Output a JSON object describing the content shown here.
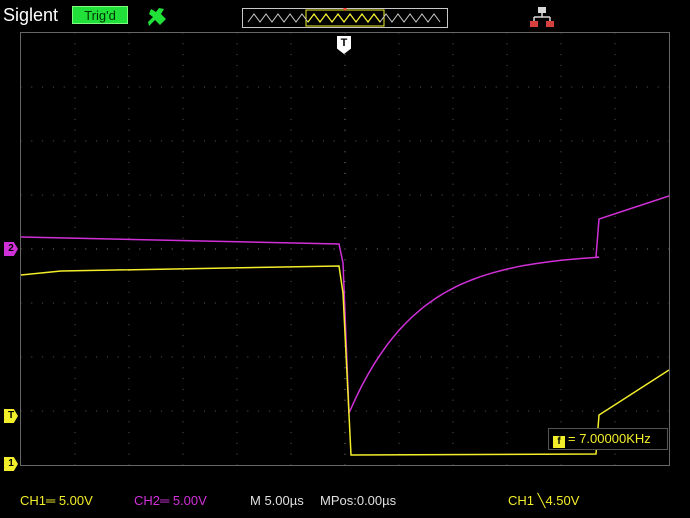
{
  "header": {
    "brand": "Siglent",
    "trigger_status": "Trig'd",
    "trigger_status_color": "#22e03a",
    "probe_icon": "probe-icon",
    "memory_icon": "memory-depth-icon",
    "network_icon": "network-icon"
  },
  "markers": {
    "ch2": "2",
    "trigger_level": "T",
    "ch1": "1",
    "trigger_position": "T"
  },
  "channels": {
    "ch1_color": "#f3ee2a",
    "ch2_color": "#d030d8"
  },
  "measurement": {
    "icon": "f",
    "frequency": "= 7.00000KHz"
  },
  "status": {
    "ch1": "CH1═ 5.00V",
    "ch2": "CH2═ 5.00V",
    "timebase": "M 5.00µs",
    "mpos": "MPos:0.00µs",
    "trigger": "CH1 ╲4.50V"
  }
}
